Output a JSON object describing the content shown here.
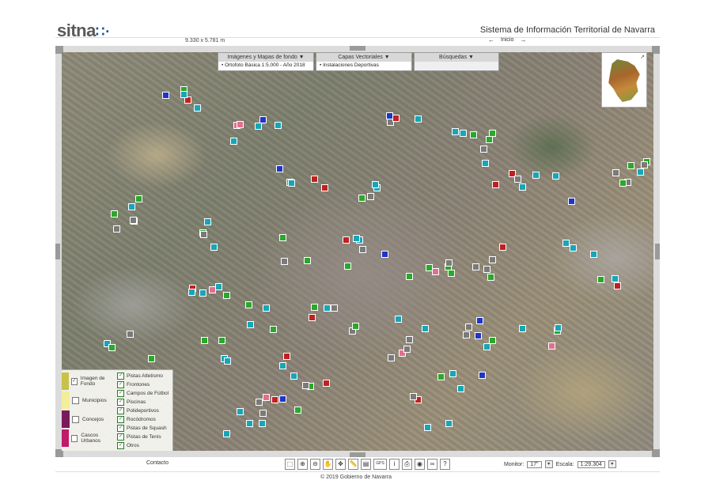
{
  "header": {
    "logo_text": "sitna",
    "logo_dots": "∷·",
    "site_title": "Sistema de Información Territorial de Navarra",
    "extent": "9.330 x 5.781 m",
    "nav_back": "←",
    "nav_label": "Inicio",
    "nav_forward": "→"
  },
  "menus": [
    {
      "title": "Imágenes y Mapas de fondo ▼",
      "item": "• Ortofoto Básica 1:5.000 - Año 2018"
    },
    {
      "title": "Capas Vectoriales ▼",
      "item": "• Instalaciones Deportivas"
    },
    {
      "title": "Búsquedas ▼",
      "item": ""
    }
  ],
  "legend": {
    "layers": [
      {
        "label": "Imagen de Fondo",
        "color": "#c8c24a",
        "checked": "✓"
      },
      {
        "label": "Municipios",
        "color": "#f2ee9a",
        "checked": ""
      },
      {
        "label": "Concejos",
        "color": "#7a1a5a",
        "checked": ""
      },
      {
        "label": "Cascos Urbanos",
        "color": "#c01a6a",
        "checked": ""
      }
    ],
    "sublayers": [
      {
        "label": "Pistas Atletismo",
        "checked": "✓"
      },
      {
        "label": "Frontones",
        "checked": "✓"
      },
      {
        "label": "Campos de Fútbol",
        "checked": "✓"
      },
      {
        "label": "Piscinas",
        "checked": "✓"
      },
      {
        "label": "Polideportivos",
        "checked": "✓"
      },
      {
        "label": "Rocódromos",
        "checked": "✓"
      },
      {
        "label": "Pistas de Squash",
        "checked": "✓"
      },
      {
        "label": "Pistas de Tenis",
        "checked": "✓"
      },
      {
        "label": "Otros",
        "checked": "✓"
      }
    ]
  },
  "minimap": {
    "close_glyph": "↗"
  },
  "footer": {
    "contact": "Contacto",
    "monitor_label": "Monitor:",
    "monitor_value": "17\"",
    "scale_label": "Escala:",
    "scale_value": "1:29.304",
    "dropdown_glyph": "▾",
    "copyright": "© 2019 Gobierno de Navarra"
  },
  "tools": [
    {
      "name": "select-tool-icon",
      "glyph": "⬚"
    },
    {
      "name": "zoom-in-icon",
      "glyph": "⊕"
    },
    {
      "name": "zoom-out-icon",
      "glyph": "⊖"
    },
    {
      "name": "pan-icon",
      "glyph": "✋"
    },
    {
      "name": "move-icon",
      "glyph": "✥"
    },
    {
      "name": "measure-icon",
      "glyph": "📏"
    },
    {
      "name": "layers-icon",
      "glyph": "▤"
    },
    {
      "name": "gps-icon",
      "glyph": "GPS"
    },
    {
      "name": "info-icon",
      "glyph": "i"
    },
    {
      "name": "print-icon",
      "glyph": "⎙"
    },
    {
      "name": "camera-icon",
      "glyph": "◉"
    },
    {
      "name": "link-icon",
      "glyph": "∞"
    },
    {
      "name": "help-icon",
      "glyph": "?"
    }
  ],
  "marker_colors": {
    "cyan": "#17a5b8",
    "green": "#2aa82a",
    "blue": "#2035c8",
    "gray": "#7a7a7a",
    "red": "#c02020",
    "pink": "#e07090"
  }
}
